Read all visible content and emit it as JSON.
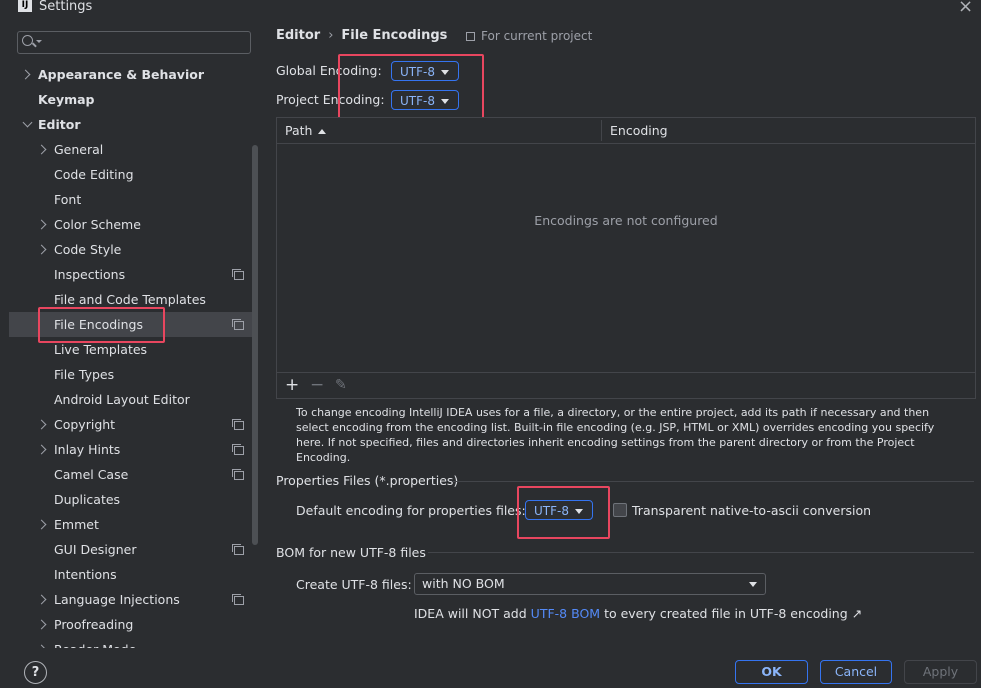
{
  "window": {
    "title": "Settings",
    "logo": "IJ"
  },
  "search": {
    "placeholder": "",
    "value": ""
  },
  "sidebar": {
    "items": [
      {
        "label": "Appearance & Behavior"
      },
      {
        "label": "Keymap"
      },
      {
        "label": "Editor"
      },
      {
        "label": "General"
      },
      {
        "label": "Code Editing"
      },
      {
        "label": "Font"
      },
      {
        "label": "Color Scheme"
      },
      {
        "label": "Code Style"
      },
      {
        "label": "Inspections"
      },
      {
        "label": "File and Code Templates"
      },
      {
        "label": "File Encodings"
      },
      {
        "label": "Live Templates"
      },
      {
        "label": "File Types"
      },
      {
        "label": "Android Layout Editor"
      },
      {
        "label": "Copyright"
      },
      {
        "label": "Inlay Hints"
      },
      {
        "label": "Camel Case"
      },
      {
        "label": "Duplicates"
      },
      {
        "label": "Emmet"
      },
      {
        "label": "GUI Designer"
      },
      {
        "label": "Intentions"
      },
      {
        "label": "Language Injections"
      },
      {
        "label": "Proofreading"
      },
      {
        "label": "Reader Mode"
      }
    ],
    "help_label": "?"
  },
  "breadcrumb": {
    "parent": "Editor",
    "separator": "›",
    "current": "File Encodings"
  },
  "scope_note": "For current project",
  "encodings": {
    "global_label": "Global Encoding:",
    "global_value": "UTF-8",
    "project_label": "Project Encoding:",
    "project_value": "UTF-8"
  },
  "table": {
    "columns": [
      "Path",
      "Encoding"
    ],
    "empty_text": "Encodings are not configured",
    "tools": {
      "add": "+",
      "remove": "−",
      "edit": "✎"
    }
  },
  "description": "To change encoding IntelliJ IDEA uses for a file, a directory, or the entire project, add its path if necessary and then select encoding from the encoding list. Built-in file encoding (e.g. JSP, HTML or XML) overrides encoding you specify here. If not specified, files and directories inherit encoding settings from the parent directory or from the Project Encoding.",
  "properties": {
    "section_title": "Properties Files (*.properties)",
    "default_label": "Default encoding for properties files:",
    "default_value": "UTF-8",
    "transparent_label": "Transparent native-to-ascii conversion"
  },
  "bom": {
    "section_title": "BOM for new UTF-8 files",
    "create_label": "Create UTF-8 files:",
    "create_value": "with NO BOM",
    "note_prefix": "IDEA will NOT add",
    "note_link": "UTF-8 BOM",
    "note_suffix": "to every created file in UTF-8 encoding ↗"
  },
  "buttons": {
    "ok": "OK",
    "cancel": "Cancel",
    "apply": "Apply"
  },
  "colors": {
    "accent": "#3574f0",
    "highlight": "#e8465f",
    "background": "#2b2d30"
  }
}
